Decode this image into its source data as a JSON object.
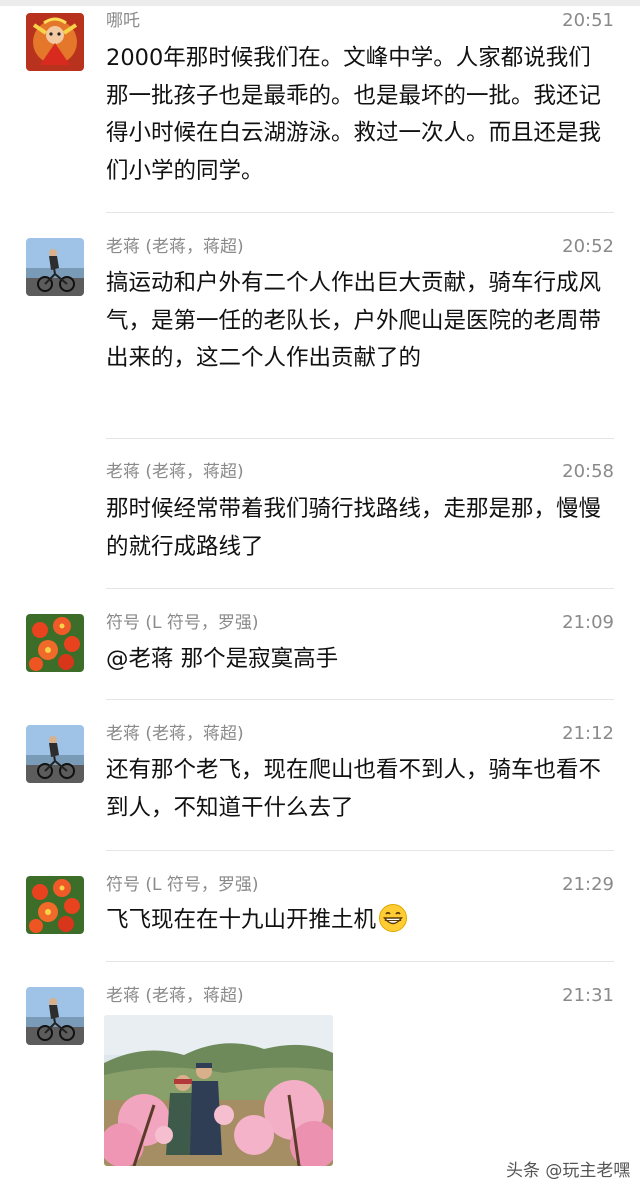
{
  "messages": [
    {
      "sender": "哪吒",
      "time": "20:51",
      "avatar_icon": "nezha-avatar",
      "text": "2000年那时候我们在。文峰中学。人家都说我们那一批孩子也是最乖的。也是最坏的一批。我还记得小时候在白云湖游泳。救过一次人。而且还是我们小学的同学。"
    },
    {
      "sender": "老蒋 (老蒋，蒋超)",
      "time": "20:52",
      "avatar_icon": "cyclist-avatar",
      "text": "搞运动和户外有二个人作出巨大贡献，骑车行成风气，是第一任的老队长，户外爬山是医院的老周带出来的，这二个人作出贡献了的"
    },
    {
      "sender": "老蒋 (老蒋，蒋超)",
      "time": "20:58",
      "avatar_icon": "cyclist-avatar",
      "text": "那时候经常带着我们骑行找路线，走那是那，慢慢的就行成路线了"
    },
    {
      "sender": "符号 (L 符号，罗强)",
      "time": "21:09",
      "avatar_icon": "flower-avatar",
      "text": "@老蒋 那个是寂寞高手"
    },
    {
      "sender": "老蒋 (老蒋，蒋超)",
      "time": "21:12",
      "avatar_icon": "cyclist-avatar",
      "text": "还有那个老飞，现在爬山也看不到人，骑车也看不到人，不知道干什么去了"
    },
    {
      "sender": "符号 (L 符号，罗强)",
      "time": "21:29",
      "avatar_icon": "flower-avatar",
      "text": "飞飞现在在十九山开推土机",
      "emoji": "grinning-face"
    },
    {
      "sender": "老蒋 (老蒋，蒋超)",
      "time": "21:31",
      "avatar_icon": "cyclist-avatar",
      "image": "peach-blossom-photo"
    }
  ],
  "watermark": "头条 @玩主老嘿",
  "colors": {
    "meta_text": "#8a8a8a",
    "body_text": "#111111",
    "divider": "#e5e5e5",
    "background": "#ffffff"
  }
}
